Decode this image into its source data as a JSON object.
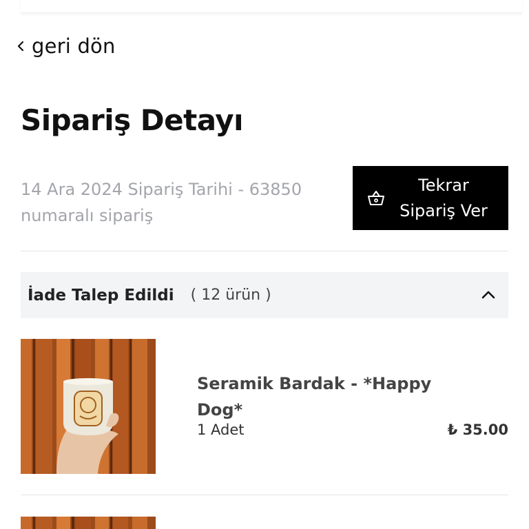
{
  "nav": {
    "back_label": "geri dön"
  },
  "page": {
    "title": "Sipariş Detayı"
  },
  "order": {
    "meta_line1": "14 Ara 2024 Sipariş Tarihi - 63850",
    "meta_line2": "numaralı sipariş",
    "reorder_line1": "Tekrar",
    "reorder_line2": "Sipariş Ver"
  },
  "section": {
    "status": "İade Talep Edildi",
    "count": "( 12 ürün )",
    "toggle_icon": "chevron-up-icon"
  },
  "items": [
    {
      "name_line1": "Seramik Bardak - *Happy",
      "name_line2": "Dog*",
      "quantity": "1 Adet",
      "price": "₺ 35.00"
    }
  ]
}
